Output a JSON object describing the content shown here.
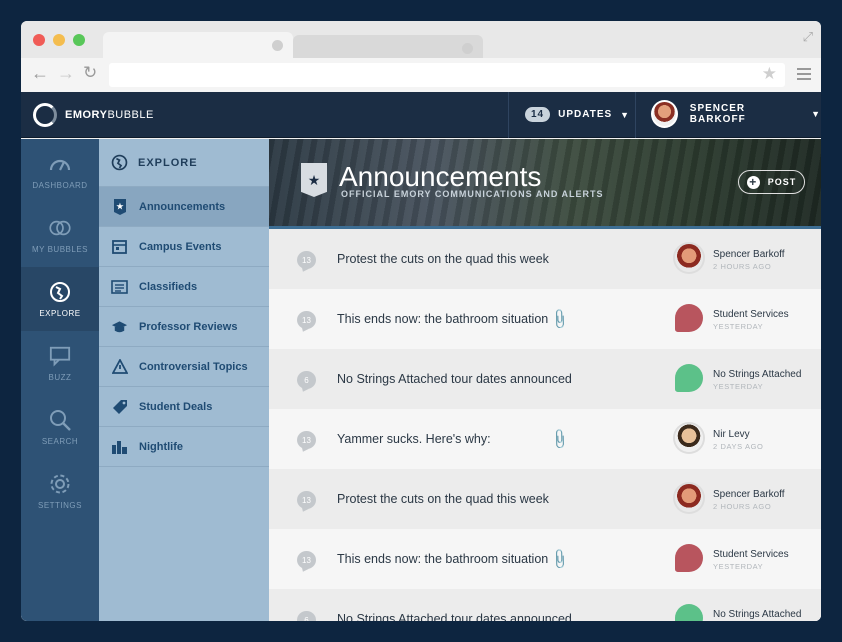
{
  "browser": {
    "colors": {
      "close": "#f05c57",
      "minimize": "#f4bd4f",
      "maximize": "#58c759"
    }
  },
  "app": {
    "logo_bold": "EMORY",
    "logo_light": "BUBBLE",
    "updates_count": "14",
    "updates_label": "UPDATES",
    "user_name": "SPENCER BARKOFF"
  },
  "rail": {
    "items": [
      {
        "label": "DASHBOARD",
        "icon": "gauge-icon"
      },
      {
        "label": "MY BUBBLES",
        "icon": "bubbles-icon"
      },
      {
        "label": "EXPLORE",
        "icon": "globe-icon"
      },
      {
        "label": "BUZZ",
        "icon": "chat-icon"
      },
      {
        "label": "SEARCH",
        "icon": "search-icon"
      },
      {
        "label": "SETTINGS",
        "icon": "gear-icon"
      }
    ]
  },
  "sub": {
    "heading": "EXPLORE",
    "items": [
      {
        "label": "Announcements",
        "icon": "shield-star-icon"
      },
      {
        "label": "Campus Events",
        "icon": "calendar-icon"
      },
      {
        "label": "Classifieds",
        "icon": "newspaper-icon"
      },
      {
        "label": "Professor Reviews",
        "icon": "graduation-cap-icon"
      },
      {
        "label": "Controversial Topics",
        "icon": "warning-icon"
      },
      {
        "label": "Student Deals",
        "icon": "tag-icon"
      },
      {
        "label": "Nightlife",
        "icon": "city-icon"
      }
    ]
  },
  "banner": {
    "title": "Announcements",
    "subtitle": "OFFICIAL EMORY COMMUNICATIONS AND ALERTS",
    "post_label": "POST"
  },
  "rows": [
    {
      "count": "13",
      "title": "Protest the cuts on the quad this week",
      "attachment": false,
      "author": "Spencer Barkoff",
      "time": "2 HOURS AGO"
    },
    {
      "count": "13",
      "title": "This ends now: the bathroom situation",
      "attachment": true,
      "author": "Student Services",
      "time": "YESTERDAY"
    },
    {
      "count": "6",
      "title": "No Strings Attached tour dates announced",
      "attachment": false,
      "author": "No Strings Attached",
      "time": "YESTERDAY"
    },
    {
      "count": "13",
      "title": "Yammer sucks. Here's why:",
      "attachment": true,
      "author": "Nir Levy",
      "time": "2 DAYS AGO"
    },
    {
      "count": "13",
      "title": "Protest the cuts on the quad this week",
      "attachment": false,
      "author": "Spencer Barkoff",
      "time": "2 HOURS AGO"
    },
    {
      "count": "13",
      "title": "This ends now: the bathroom situation",
      "attachment": true,
      "author": "Student Services",
      "time": "YESTERDAY"
    },
    {
      "count": "6",
      "title": "No Strings Attached tour dates announced",
      "attachment": false,
      "author": "No Strings Attached",
      "time": ""
    }
  ]
}
